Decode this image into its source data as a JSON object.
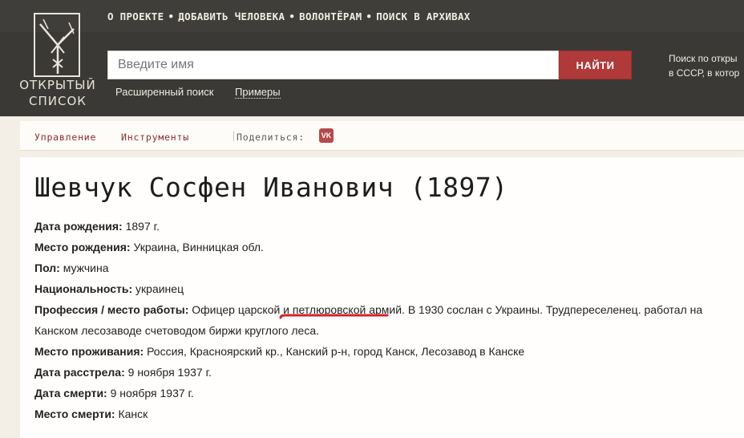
{
  "logo": {
    "line1": "ОТКРЫТЫЙ",
    "line2": "СПИСОК"
  },
  "topnav": [
    "О ПРОЕКТЕ",
    "ДОБАВИТЬ ЧЕЛОВЕКА",
    "ВОЛОНТЁРАМ",
    "ПОИСК В АРХИВАХ"
  ],
  "topnav_separator": "•",
  "search": {
    "placeholder": "Введите имя",
    "button": "НАЙТИ",
    "advanced": "Расширенный поиск",
    "examples": "Примеры"
  },
  "side_text": {
    "line1": "Поиск по откры",
    "line2": "в СССР, в котор"
  },
  "toolbar": {
    "manage": "Управление",
    "tools": "Инструменты",
    "share": "Поделиться:",
    "vk": "VK"
  },
  "person": {
    "title": "Шевчук Сосфен Иванович (1897)",
    "fields": [
      {
        "label": "Дата рождения:",
        "value": "1897 г."
      },
      {
        "label": "Место рождения:",
        "value": "Украина, Винницкая обл."
      },
      {
        "label": "Пол:",
        "value": "мужчина"
      },
      {
        "label": "Национальность:",
        "value": "украинец"
      },
      {
        "label": "Профессия / место работы:",
        "value": "Офицер царской и петлюровской армий. В 1930 сослан с Украины. Трудпереселенец. работал на Канском лесозаводе счетоводом биржи круглого леса."
      },
      {
        "label": "Место проживания:",
        "value": "Россия, Красноярский кр., Канский р-н, город Канск, Лесозавод в Канске"
      },
      {
        "label": "Дата расстрела:",
        "value": "9 ноября 1937 г."
      },
      {
        "label": "Дата смерти:",
        "value": "9 ноября 1937 г."
      },
      {
        "label": "Место смерти:",
        "value": "Канск"
      }
    ]
  },
  "colors": {
    "header": "#3a3936",
    "accent_red": "#b03a3a",
    "annotation": "#d4222a",
    "page_bg": "#f3eee6"
  }
}
